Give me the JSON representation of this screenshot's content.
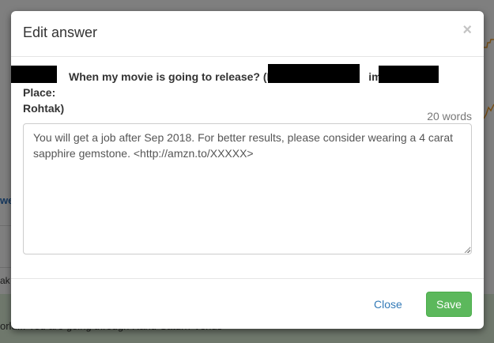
{
  "background": {
    "left_text": "we",
    "left_text2": "ak",
    "banner_text": "orld... You are going through Rahu-Saturn-Venus"
  },
  "modal": {
    "title": "Edit answer",
    "close_symbol": "×",
    "question_part1": "When my movie is going to release? (DoB",
    "question_part2": "ime",
    "question_part3": "Place:",
    "question_part4": "Rohtak)",
    "word_count": "20 words",
    "answer_text": "You will get a job after Sep 2018.  For better results, please consider wearing a 4 carat sapphire gemstone.  <http://amzn.to/XXXXX>",
    "close_label": "Close",
    "save_label": "Save"
  },
  "colors": {
    "save_button": "#5cb85c",
    "link": "#337ab7",
    "overlay": "#000000"
  }
}
